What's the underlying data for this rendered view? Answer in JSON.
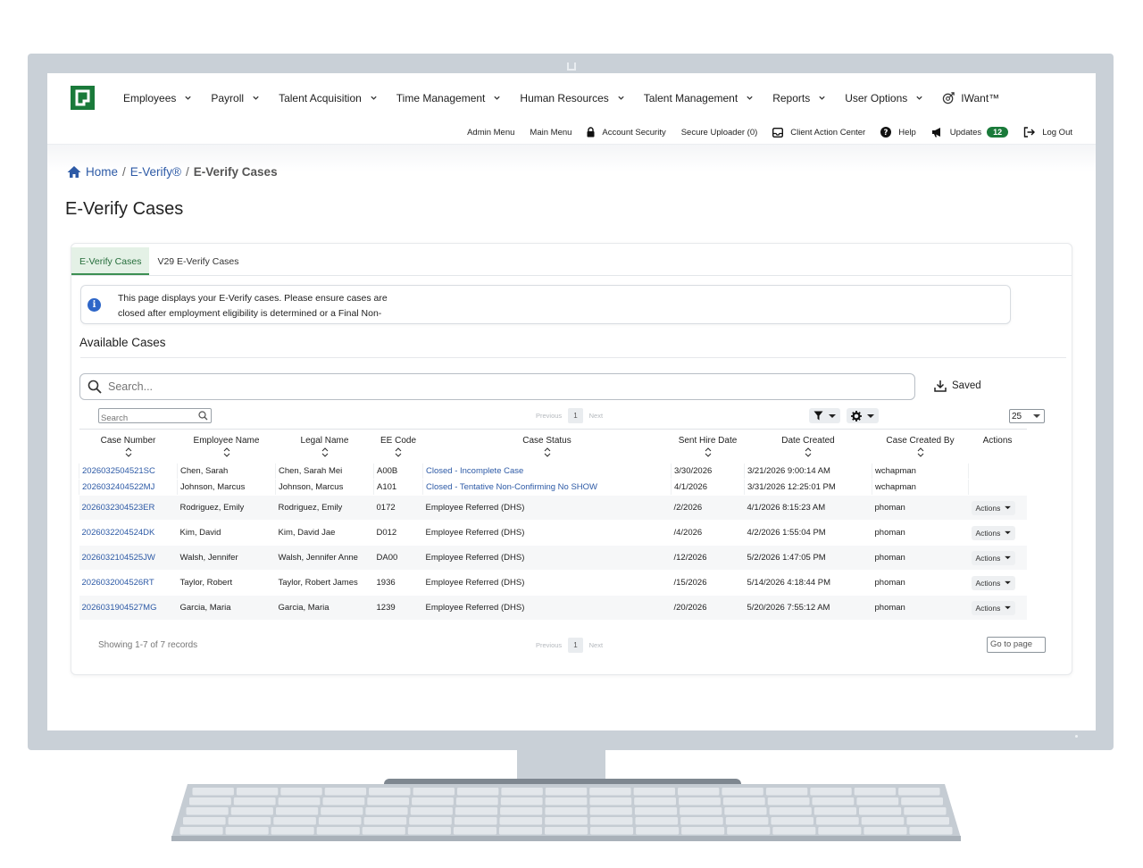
{
  "nav": {
    "menu": [
      "Employees",
      "Payroll",
      "Talent Acquisition",
      "Time Management",
      "Human Resources",
      "Talent Management",
      "Reports",
      "User Options"
    ],
    "iwant": "IWant™"
  },
  "util": {
    "admin_menu": "Admin Menu",
    "main_menu": "Main Menu",
    "account_security": "Account Security",
    "secure_uploader": "Secure Uploader (0)",
    "client_action_center": "Client Action Center",
    "help": "Help",
    "updates": "Updates",
    "updates_count": "12",
    "log_out": "Log Out"
  },
  "breadcrumb": {
    "home": "Home",
    "everify": "E-Verify®",
    "current": "E-Verify Cases"
  },
  "page_title": "E-Verify Cases",
  "tabs": [
    "E-Verify Cases",
    "V29 E-Verify Cases"
  ],
  "info_text": "This page displays your E-Verify cases. Please ensure cases are closed after employment eligibility is determined or a Final Non-Confirmation is issued.",
  "available_cases": "Available Cases",
  "search": {
    "placeholder": "Search...",
    "small_placeholder": "Search"
  },
  "saved_label": "Saved",
  "pager": {
    "previous": "Previous",
    "page": "1",
    "next": "Next"
  },
  "per_page": "25",
  "columns": [
    "Case Number",
    "Employee Name",
    "Legal Name",
    "EE Code",
    "Case Status",
    "Sent Hire Date",
    "Date Created",
    "Case Created By",
    "Actions"
  ],
  "rows": [
    {
      "case_number": "2026032504521SC",
      "employee_name": "Chen, Sarah",
      "legal_name": "Chen, Sarah Mei",
      "ee_code": "A00B",
      "status": "Closed - Incomplete Case",
      "sent_hire_date": "3/30/2026",
      "date_created": "3/21/2026 9:00:14 AM",
      "created_by": "wchapman",
      "action": ""
    },
    {
      "case_number": "2026032404522MJ",
      "employee_name": "Johnson, Marcus",
      "legal_name": "Johnson, Marcus",
      "ee_code": "A101",
      "status": "Closed - Tentative Non-Confirming No SHOW",
      "sent_hire_date": "4/1/2026",
      "date_created": "3/31/2026 12:25:01 PM",
      "created_by": "wchapman",
      "action": ""
    },
    {
      "case_number": "2026032304523ER",
      "employee_name": "Rodriguez, Emily",
      "legal_name": "Rodriguez, Emily",
      "ee_code": "0172",
      "status": "Employee Referred (DHS)",
      "sent_hire_date": "/2/2026",
      "date_created": "4/1/2026 8:15:23 AM",
      "created_by": "phoman",
      "action": "Actions"
    },
    {
      "case_number": "2026032204524DK",
      "employee_name": "Kim, David",
      "legal_name": "Kim, David Jae",
      "ee_code": "D012",
      "status": "Employee Referred (DHS)",
      "sent_hire_date": "/4/2026",
      "date_created": "4/2/2026 1:55:04 PM",
      "created_by": "phoman",
      "action": "Actions"
    },
    {
      "case_number": "2026032104525JW",
      "employee_name": "Walsh, Jennifer",
      "legal_name": "Walsh, Jennifer Anne",
      "ee_code": "DA00",
      "status": "Employee Referred (DHS)",
      "sent_hire_date": "/12/2026",
      "date_created": "5/2/2026 1:47:05 PM",
      "created_by": "phoman",
      "action": "Actions"
    },
    {
      "case_number": "2026032004526RT",
      "employee_name": "Taylor, Robert",
      "legal_name": "Taylor, Robert James",
      "ee_code": "1936",
      "status": "Employee Referred (DHS)",
      "sent_hire_date": "/15/2026",
      "date_created": "5/14/2026 4:18:44 PM",
      "created_by": "phoman",
      "action": "Actions"
    },
    {
      "case_number": "2026031904527MG",
      "employee_name": "Garcia, Maria",
      "legal_name": "Garcia, Maria",
      "ee_code": "1239",
      "status": "Employee Referred (DHS)",
      "sent_hire_date": "/20/2026",
      "date_created": "5/20/2026 7:55:12 AM",
      "created_by": "phoman",
      "action": "Actions"
    }
  ],
  "showing": "Showing 1-7 of 7 records",
  "goto_placeholder": "Go to page",
  "colors": {
    "brand_green": "#1a7a3a",
    "link_blue": "#2d5aa6"
  }
}
